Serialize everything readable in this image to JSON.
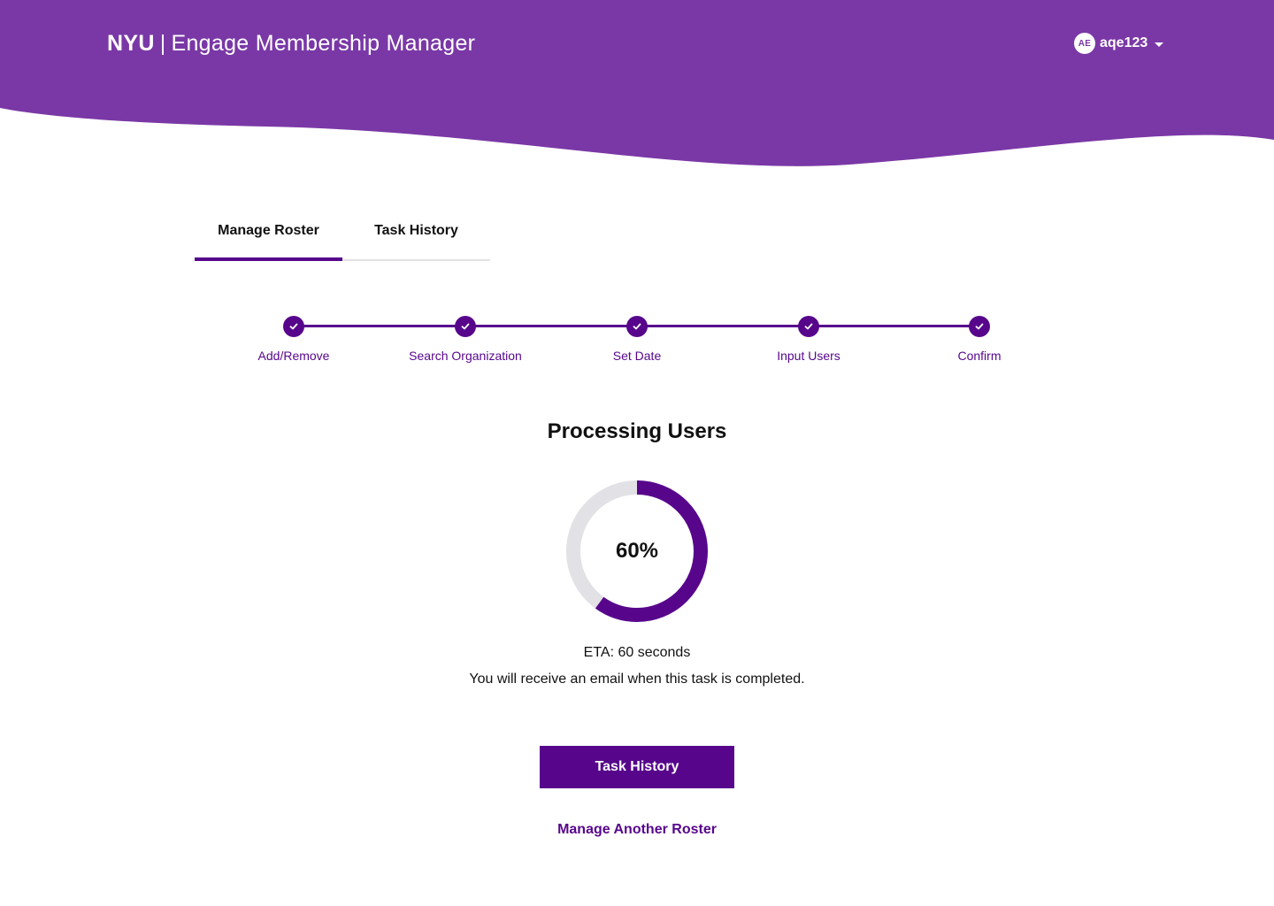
{
  "colors": {
    "header": "#7a38a6",
    "primary": "#57068c",
    "track": "#e2e2e6",
    "text": "#111111"
  },
  "header": {
    "brand": "NYU",
    "separator": "|",
    "app_name": "Engage Membership Manager",
    "user": {
      "initials": "AE",
      "username": "aqe123",
      "menu_icon": "caret-down-icon"
    }
  },
  "tabs": [
    {
      "label": "Manage Roster",
      "active": true
    },
    {
      "label": "Task History",
      "active": false
    }
  ],
  "steps": [
    {
      "label": "Add/Remove",
      "completed": true,
      "icon": "check-icon"
    },
    {
      "label": "Search Organization",
      "completed": true,
      "icon": "check-icon"
    },
    {
      "label": "Set Date",
      "completed": true,
      "icon": "check-icon"
    },
    {
      "label": "Input Users",
      "completed": true,
      "icon": "check-icon"
    },
    {
      "label": "Confirm",
      "completed": true,
      "icon": "check-icon"
    }
  ],
  "processing": {
    "title": "Processing Users",
    "progress_percent": 60,
    "progress_label": "60%",
    "eta": "ETA: 60 seconds",
    "notice": "You will receive an email when this task is completed."
  },
  "actions": {
    "primary_label": "Task History",
    "secondary_label": "Manage Another Roster"
  }
}
